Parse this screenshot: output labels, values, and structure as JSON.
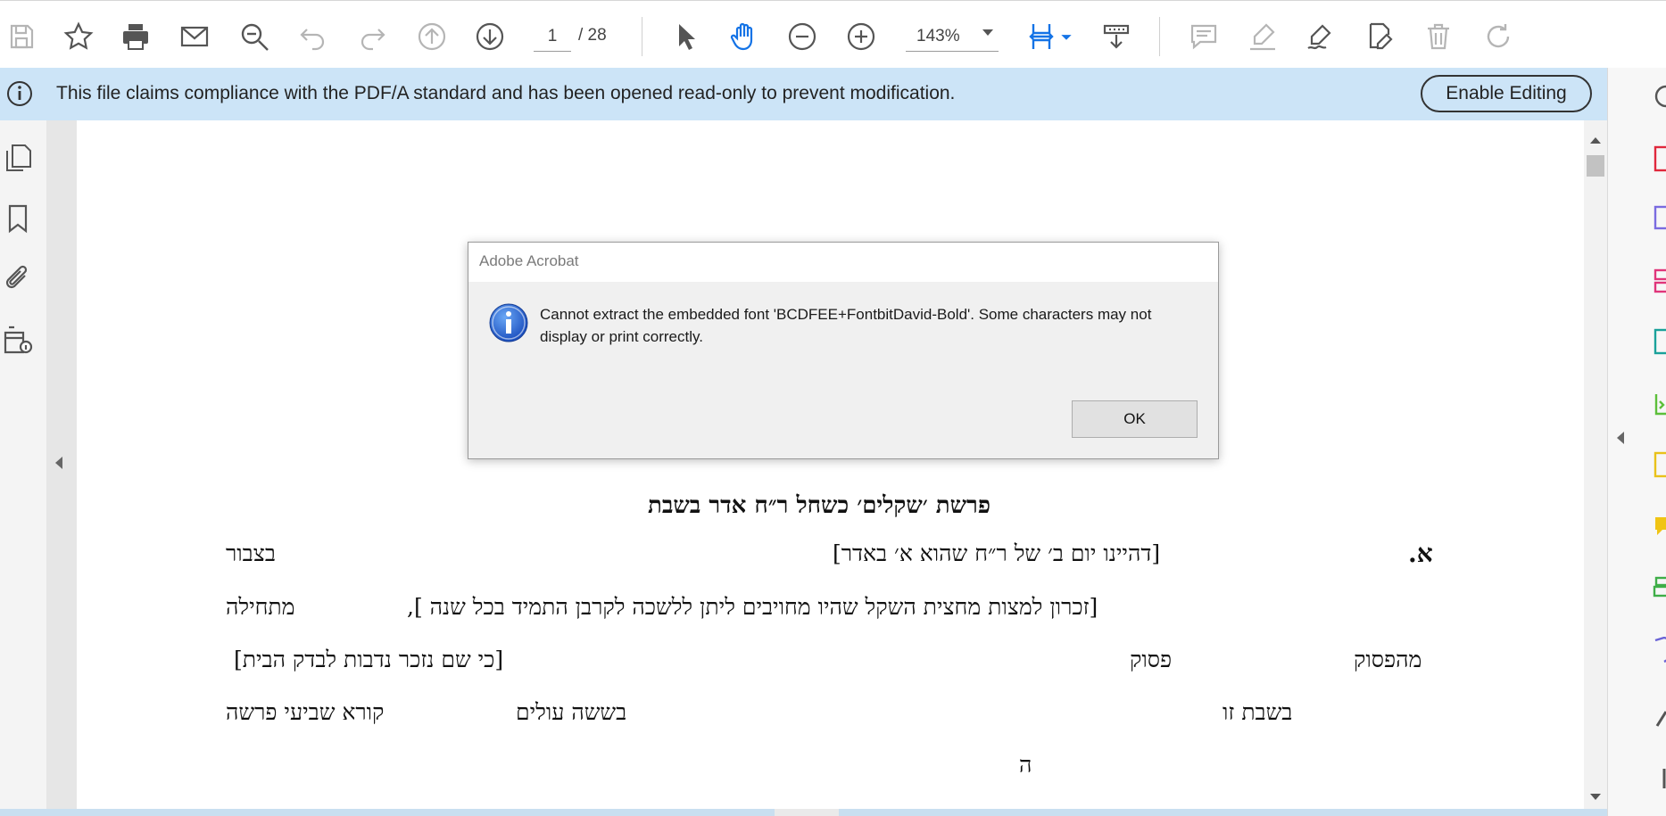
{
  "toolbar": {
    "page_current": "1",
    "page_total": "/ 28",
    "zoom": "143%",
    "icons": [
      "save-icon",
      "bookmark-star-icon",
      "print-icon",
      "email-icon",
      "search-icon",
      "undo-icon",
      "redo-icon",
      "previous-page-icon",
      "next-page-icon",
      "select-cursor-icon",
      "hand-tool-icon",
      "zoom-out-icon",
      "zoom-in-icon",
      "fit-page-icon",
      "scrolling-mode-icon",
      "comment-icon",
      "highlight-icon",
      "sign-icon",
      "edit-pdf-icon",
      "delete-icon",
      "rotate-icon"
    ]
  },
  "infobar": {
    "message": "This file claims compliance with the PDF/A standard and has been opened read-only to prevent modification.",
    "button": "Enable Editing"
  },
  "dialog": {
    "title": "Adobe Acrobat",
    "message": "Cannot extract the embedded font 'BCDFEE+FontbitDavid-Bold'. Some characters may not display or print correctly.",
    "ok": "OK"
  },
  "document": {
    "title": "פרשת ׳שקלים׳ כשחל ר״ח אדר בשבת",
    "letter": "א.",
    "line1_bracket": "[דהיינו יום ב׳ של ר״ח שהוא א׳ באדר]",
    "line1_left": "בצבור",
    "line2_bracket": "[זכרון למצות מחצית השקל שהיו מחויבים ליתן ללשכה לקרבן התמיד בכל שנה ],",
    "line2_left": "מתחילה",
    "line3_right": "מהפסוק",
    "line3_mid": "פסוק",
    "line3_left": "[כי שם נזכר נדבות לבדק הבית]",
    "line4_right": "בשבת זו",
    "line4_mid": "בששה עולים",
    "line4_left": "קורא שביעי פרשה",
    "line5": "ה"
  },
  "colors": {
    "infobar": "#cce4f7",
    "accent_blue": "#1473e6"
  }
}
